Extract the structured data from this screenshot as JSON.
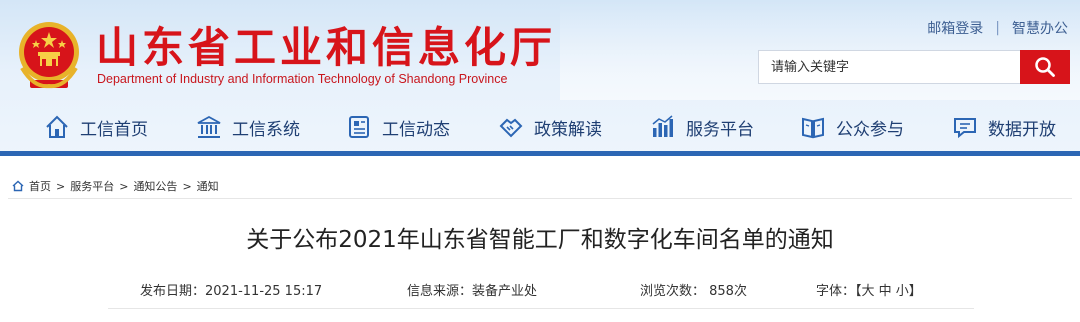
{
  "site": {
    "title": "山东省工业和信息化厅",
    "subtitle": "Department of Industry and Information Technology of Shandong Province"
  },
  "top_links": {
    "mail": "邮箱登录",
    "separator": "|",
    "smart_office": "智慧办公"
  },
  "search": {
    "placeholder": "请输入关键字"
  },
  "nav": {
    "items": [
      {
        "label": "工信首页",
        "icon": "home-icon"
      },
      {
        "label": "工信系统",
        "icon": "institution-icon"
      },
      {
        "label": "工信动态",
        "icon": "news-icon"
      },
      {
        "label": "政策解读",
        "icon": "handshake-icon"
      },
      {
        "label": "服务平台",
        "icon": "bar-chart-icon"
      },
      {
        "label": "公众参与",
        "icon": "book-icon"
      },
      {
        "label": "数据开放",
        "icon": "message-icon"
      }
    ]
  },
  "breadcrumb": {
    "items": [
      "首页",
      "服务平台",
      "通知公告",
      "通知"
    ],
    "separator": ">"
  },
  "article": {
    "title": "关于公布2021年山东省智能工厂和数字化车间名单的通知",
    "publish_date": "发布日期：2021-11-25 15:17",
    "source": "信息来源：装备产业处",
    "views": "浏览次数： 858次",
    "font_size": "字体：【大 中 小】"
  },
  "colors": {
    "brand_red": "#d7141a",
    "nav_blue": "#2c66b4",
    "nav_text": "#1f3f73"
  }
}
